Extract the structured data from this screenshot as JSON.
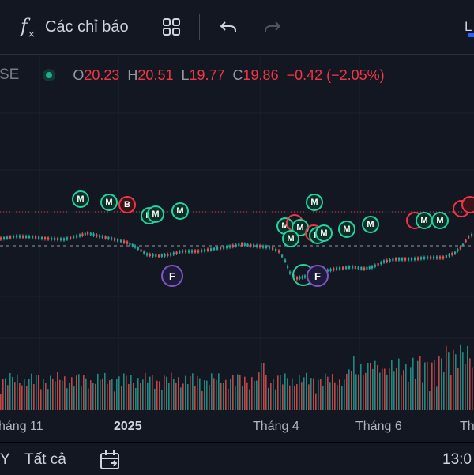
{
  "toolbar": {
    "fx_icon_text": "f",
    "indicators_label": "Các chỉ báo",
    "right_edge_text": "L"
  },
  "legend": {
    "symbol_tail": "SE",
    "o_label": "O",
    "o_value": "20.23",
    "h_label": "H",
    "h_value": "20.51",
    "l_label": "L",
    "l_value": "19.77",
    "c_label": "C",
    "c_value": "19.86",
    "change": "−0.42 (−2.05%)"
  },
  "events": {
    "m": "M",
    "b": "B",
    "f": "F"
  },
  "time_axis": {
    "labels": [
      "háng 11",
      "2025",
      "Tháng 4",
      "Tháng 6",
      "Th"
    ]
  },
  "bottombar": {
    "range_tail": "Y",
    "all_label": "Tất cả",
    "time_text": "13:0"
  },
  "colors": {
    "up": "#26a69a",
    "down": "#ef5350",
    "event_green": "#22d3a0",
    "event_red": "#f23645",
    "dividend": "#7e57c2"
  }
}
